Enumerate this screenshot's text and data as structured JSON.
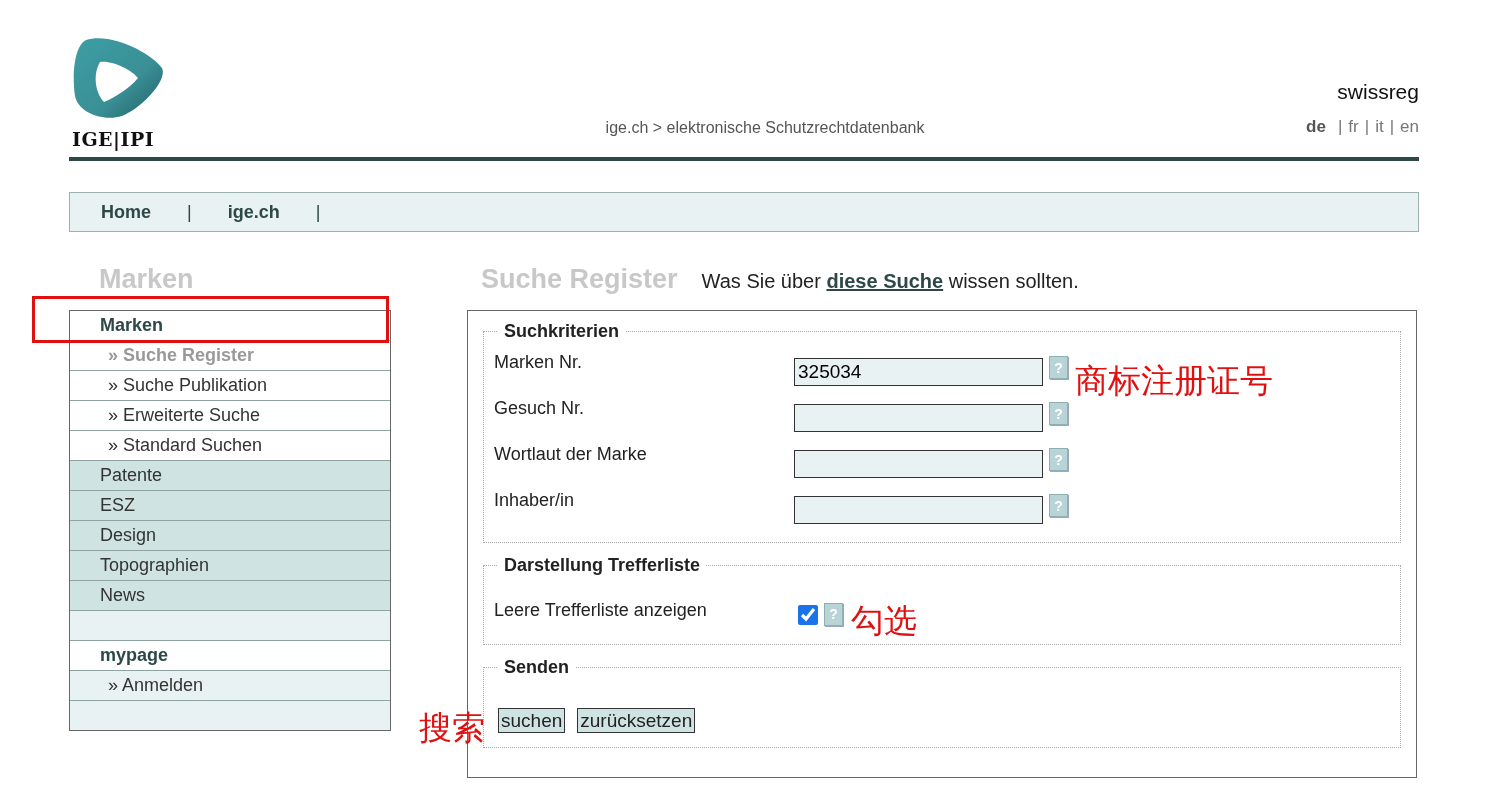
{
  "header": {
    "logo_text": "IGE|IPI",
    "breadcrumb": "ige.ch > elektronische Schutzrechtdatenbank",
    "site_name": "swissreg",
    "languages": [
      {
        "label": "de",
        "selected": true
      },
      {
        "label": "fr",
        "selected": false
      },
      {
        "label": "it",
        "selected": false
      },
      {
        "label": "en",
        "selected": false
      }
    ],
    "separator": "|"
  },
  "nav": {
    "items": [
      "Home",
      "ige.ch"
    ],
    "separator": "|"
  },
  "sidebar": {
    "title": "Marken",
    "items": [
      {
        "kind": "section",
        "label": "Marken",
        "selected": false
      },
      {
        "kind": "sub",
        "label": "» Suche Register",
        "selected": true
      },
      {
        "kind": "sub",
        "label": "» Suche Publikation",
        "selected": false
      },
      {
        "kind": "sub",
        "label": "» Erweiterte Suche",
        "selected": false
      },
      {
        "kind": "sub",
        "label": "» Standard Suchen",
        "selected": false
      },
      {
        "kind": "category",
        "label": "Patente",
        "selected": false
      },
      {
        "kind": "category",
        "label": "ESZ",
        "selected": false
      },
      {
        "kind": "category",
        "label": "Design",
        "selected": false
      },
      {
        "kind": "category",
        "label": "Topographien",
        "selected": false
      },
      {
        "kind": "category",
        "label": "News",
        "selected": false
      },
      {
        "kind": "spacer"
      },
      {
        "kind": "section",
        "label": "mypage",
        "selected": false
      },
      {
        "kind": "login",
        "label": "» Anmelden",
        "selected": false
      },
      {
        "kind": "spacer"
      }
    ]
  },
  "main": {
    "title": "Suche Register",
    "intro_parts": {
      "before": "Was Sie über ",
      "link": "diese Suche",
      "after": " wissen sollten."
    },
    "criteria": {
      "legend": "Suchkriterien",
      "fields": [
        {
          "label": "Marken Nr.",
          "value": "325034",
          "help": "?"
        },
        {
          "label": "Gesuch Nr.",
          "help": "?"
        },
        {
          "label": "Wortlaut der Marke",
          "help": "?"
        },
        {
          "label": "Inhaber/in",
          "help": "?"
        }
      ]
    },
    "display": {
      "legend": "Darstellung Trefferliste",
      "label": "Leere Trefferliste anzeigen",
      "checked": true,
      "help": "?"
    },
    "send": {
      "legend": "Senden",
      "buttons": [
        "suchen",
        "zurücksetzen"
      ]
    }
  },
  "annotations": {
    "trademark_number": "商标注册证号",
    "check": "勾选",
    "search": "搜索"
  }
}
